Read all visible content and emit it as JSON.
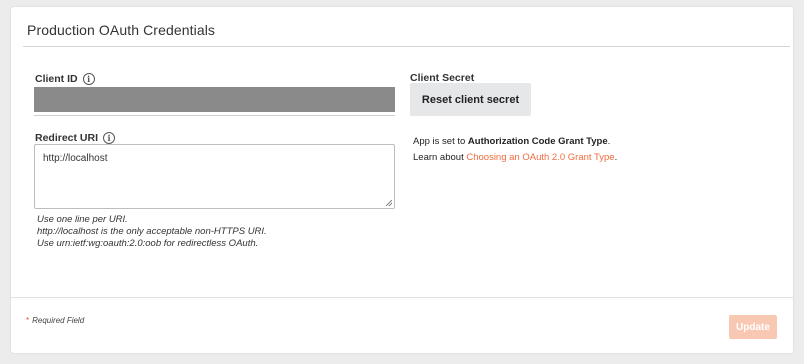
{
  "card": {
    "title": "Production OAuth Credentials"
  },
  "client_id": {
    "label": "Client ID",
    "value_redacted": true
  },
  "redirect_uri": {
    "label": "Redirect URI",
    "value": "http://localhost",
    "hints": [
      "Use one line per URI.",
      "http://localhost is the only acceptable non-HTTPS URI.",
      "Use urn:ietf:wg:oauth:2.0:oob for redirectless OAuth."
    ]
  },
  "client_secret": {
    "label": "Client Secret",
    "reset_button_label": "Reset client secret"
  },
  "grant_info": {
    "prefix": "App is set to ",
    "grant_type": "Authorization Code Grant Type",
    "suffix": ".",
    "learn_prefix": "Learn about ",
    "link_text": "Choosing an OAuth 2.0 Grant Type",
    "link_suffix": "."
  },
  "footer": {
    "required_star": "*",
    "required_text": "Required Field",
    "update_label": "Update",
    "update_enabled": false
  },
  "colors": {
    "accent": "#ef6c3e",
    "button_disabled_bg": "#f9c8b2",
    "redaction": "#8a8a8a"
  },
  "icons": {
    "info": "info-icon"
  }
}
